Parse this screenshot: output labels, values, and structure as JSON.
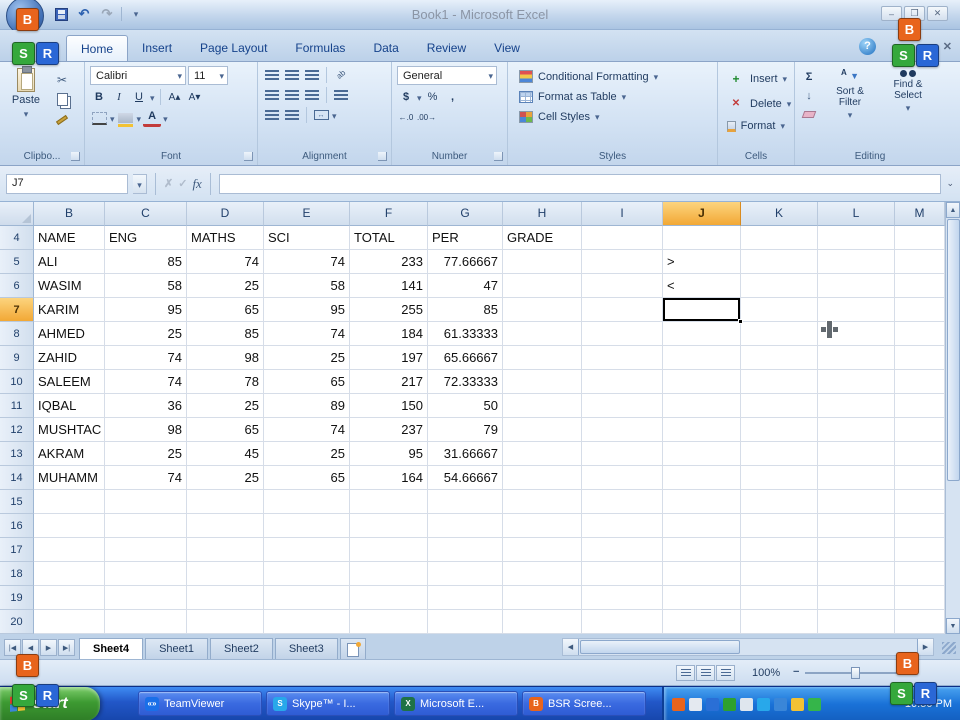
{
  "titlebar": {
    "title": "Book1 - Microsoft Excel",
    "quick_access_icons": [
      "save-icon",
      "undo-icon",
      "redo-icon",
      "customize-quick-access-arrow-icon"
    ]
  },
  "ribbon": {
    "tabs": [
      {
        "label": "Home",
        "active": true
      },
      {
        "label": "Insert"
      },
      {
        "label": "Page Layout"
      },
      {
        "label": "Formulas"
      },
      {
        "label": "Data"
      },
      {
        "label": "Review"
      },
      {
        "label": "View"
      }
    ],
    "clipboard": {
      "paste": "Paste",
      "label": "Clipbo..."
    },
    "font": {
      "family": "Calibri",
      "size": "11",
      "bold": "B",
      "italic": "I",
      "underline": "U",
      "label": "Font"
    },
    "alignment": {
      "label": "Alignment"
    },
    "number": {
      "format": "General",
      "currency": "$",
      "percent": "%",
      "comma": ",",
      "label": "Number"
    },
    "styles": {
      "buttons": [
        "Conditional Formatting",
        "Format as Table",
        "Cell Styles"
      ],
      "label": "Styles"
    },
    "cells": {
      "buttons": [
        "Insert",
        "Delete",
        "Format"
      ],
      "label": "Cells"
    },
    "editing": {
      "autosum": "Σ",
      "buttons": [
        "Sort & Filter",
        "Find & Select"
      ],
      "label": "Editing"
    }
  },
  "formula_bar": {
    "name_box": "J7",
    "fx": "fx",
    "value": ""
  },
  "grid": {
    "columns": [
      "B",
      "C",
      "D",
      "E",
      "F",
      "G",
      "H",
      "I",
      "J",
      "K",
      "L",
      "M"
    ],
    "selected": {
      "column": "J",
      "row": 7
    },
    "rows": [
      {
        "n": 4,
        "cells": {
          "B": "NAME",
          "C": "ENG",
          "D": "MATHS",
          "E": "SCI",
          "F": "TOTAL",
          "G": "PER",
          "H": "GRADE"
        }
      },
      {
        "n": 5,
        "cells": {
          "B": "ALI",
          "C": 85,
          "D": 74,
          "E": 74,
          "F": 233,
          "G": 77.66667,
          "J": ">"
        }
      },
      {
        "n": 6,
        "cells": {
          "B": "WASIM",
          "C": 58,
          "D": 25,
          "E": 58,
          "F": 141,
          "G": 47,
          "J": "<"
        }
      },
      {
        "n": 7,
        "cells": {
          "B": "KARIM",
          "C": 95,
          "D": 65,
          "E": 95,
          "F": 255,
          "G": 85
        }
      },
      {
        "n": 8,
        "cells": {
          "B": "AHMED",
          "C": 25,
          "D": 85,
          "E": 74,
          "F": 184,
          "G": 61.33333
        }
      },
      {
        "n": 9,
        "cells": {
          "B": "ZAHID",
          "C": 74,
          "D": 98,
          "E": 25,
          "F": 197,
          "G": 65.66667
        }
      },
      {
        "n": 10,
        "cells": {
          "B": "SALEEM",
          "C": 74,
          "D": 78,
          "E": 65,
          "F": 217,
          "G": 72.33333
        }
      },
      {
        "n": 11,
        "cells": {
          "B": "IQBAL",
          "C": 36,
          "D": 25,
          "E": 89,
          "F": 150,
          "G": 50
        }
      },
      {
        "n": 12,
        "cells": {
          "B": "MUSHTAC",
          "C": 98,
          "D": 65,
          "E": 74,
          "F": 237,
          "G": 79
        }
      },
      {
        "n": 13,
        "cells": {
          "B": "AKRAM",
          "C": 25,
          "D": 45,
          "E": 25,
          "F": 95,
          "G": 31.66667
        }
      },
      {
        "n": 14,
        "cells": {
          "B": "MUHAMM",
          "C": 74,
          "D": 25,
          "E": 65,
          "F": 164,
          "G": 54.66667
        }
      },
      {
        "n": 15,
        "cells": {}
      },
      {
        "n": 16,
        "cells": {}
      },
      {
        "n": 17,
        "cells": {}
      },
      {
        "n": 18,
        "cells": {}
      },
      {
        "n": 19,
        "cells": {}
      },
      {
        "n": 20,
        "cells": {}
      }
    ]
  },
  "sheet_tabs": [
    {
      "label": "Sheet4",
      "active": true
    },
    {
      "label": "Sheet1"
    },
    {
      "label": "Sheet2"
    },
    {
      "label": "Sheet3"
    }
  ],
  "status_bar": {
    "zoom": "100%",
    "view_icons": [
      "normal-view-icon",
      "page-layout-view-icon",
      "page-break-preview-icon"
    ]
  },
  "taskbar": {
    "start": "start",
    "tasks": [
      {
        "label": "TeamViewer",
        "icon": "teamviewer-icon",
        "color": "#1a6fe8",
        "glyph": "«»"
      },
      {
        "label": "Skype™ - I...",
        "icon": "skype-icon",
        "color": "#28a8ea",
        "glyph": "S"
      },
      {
        "label": "Microsoft E...",
        "icon": "excel-icon",
        "color": "#1f7246",
        "glyph": "X"
      },
      {
        "label": "BSR Scree...",
        "icon": "bsr-icon",
        "color": "#e8641c",
        "glyph": "B"
      }
    ],
    "tray_icons": [
      {
        "name": "tray-recorder-icon",
        "color": "#e8641c"
      },
      {
        "name": "tray-keyboard-icon",
        "color": "#e4e9f0"
      },
      {
        "name": "tray-teamviewer-icon",
        "color": "#2a6fd6"
      },
      {
        "name": "tray-shield-icon",
        "color": "#2ea12e"
      },
      {
        "name": "tray-volume-icon",
        "color": "#dfe6ee"
      },
      {
        "name": "tray-skype-icon",
        "color": "#28a8ea"
      },
      {
        "name": "tray-network-icon",
        "color": "#3a86d8"
      },
      {
        "name": "tray-alert-icon",
        "color": "#f2c234"
      },
      {
        "name": "tray-messenger-icon",
        "color": "#35b54a"
      }
    ],
    "time": "10:50 PM"
  },
  "overlay_badges": {
    "letters": [
      "B",
      "S",
      "R"
    ],
    "colors": {
      "B": "#e8641c",
      "S": "#35a83c",
      "R": "#2a67d6"
    }
  }
}
